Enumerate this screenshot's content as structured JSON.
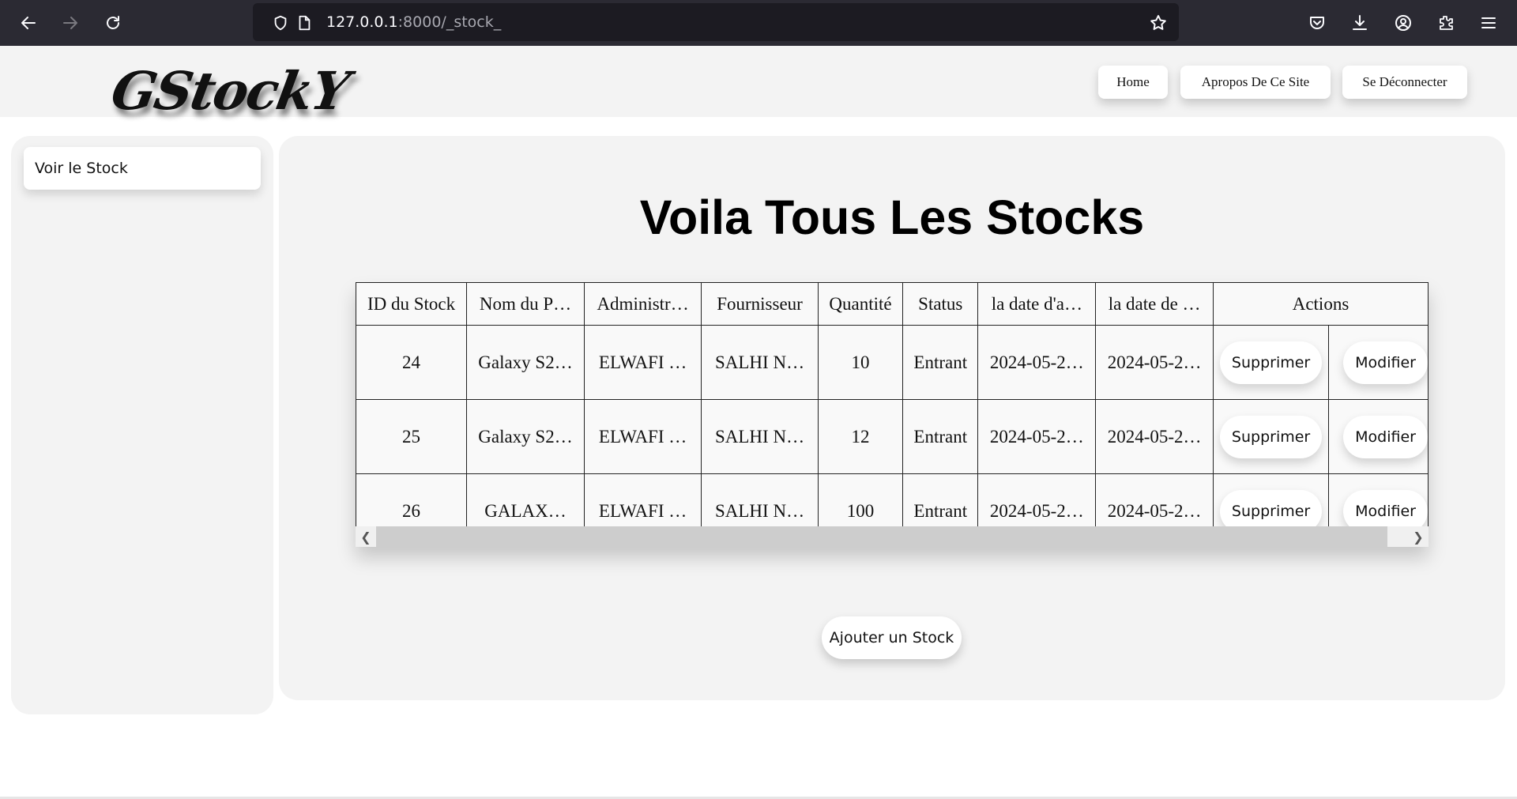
{
  "browser": {
    "url_host": "127.0.0.1",
    "url_path": ":8000/_stock_"
  },
  "header": {
    "logo": "GStockY",
    "nav": [
      "Home",
      "Apropos De Ce Site",
      "Se Déconnecter"
    ]
  },
  "sidebar": {
    "items": [
      {
        "label": "Voir le Stock"
      }
    ]
  },
  "main": {
    "title": "Voila Tous Les Stocks",
    "table": {
      "headers": [
        "ID du Stock",
        "Nom du P…",
        "Administr…",
        "Fournisseur",
        "Quantité",
        "Status",
        "la date d'a…",
        "la date de …",
        "Actions"
      ],
      "rows": [
        [
          "24",
          "Galaxy S2…",
          "ELWAFI …",
          "SALHI N…",
          "10",
          "Entrant",
          "2024-05-2…",
          "2024-05-2…"
        ],
        [
          "25",
          "Galaxy S2…",
          "ELWAFI …",
          "SALHI N…",
          "12",
          "Entrant",
          "2024-05-2…",
          "2024-05-2…"
        ],
        [
          "26",
          "GALAX…",
          "ELWAFI …",
          "SALHI N…",
          "100",
          "Entrant",
          "2024-05-2…",
          "2024-05-2…"
        ]
      ],
      "delete_label": "Supprimer",
      "edit_label": "Modifier"
    },
    "add_label": "Ajouter un Stock"
  }
}
